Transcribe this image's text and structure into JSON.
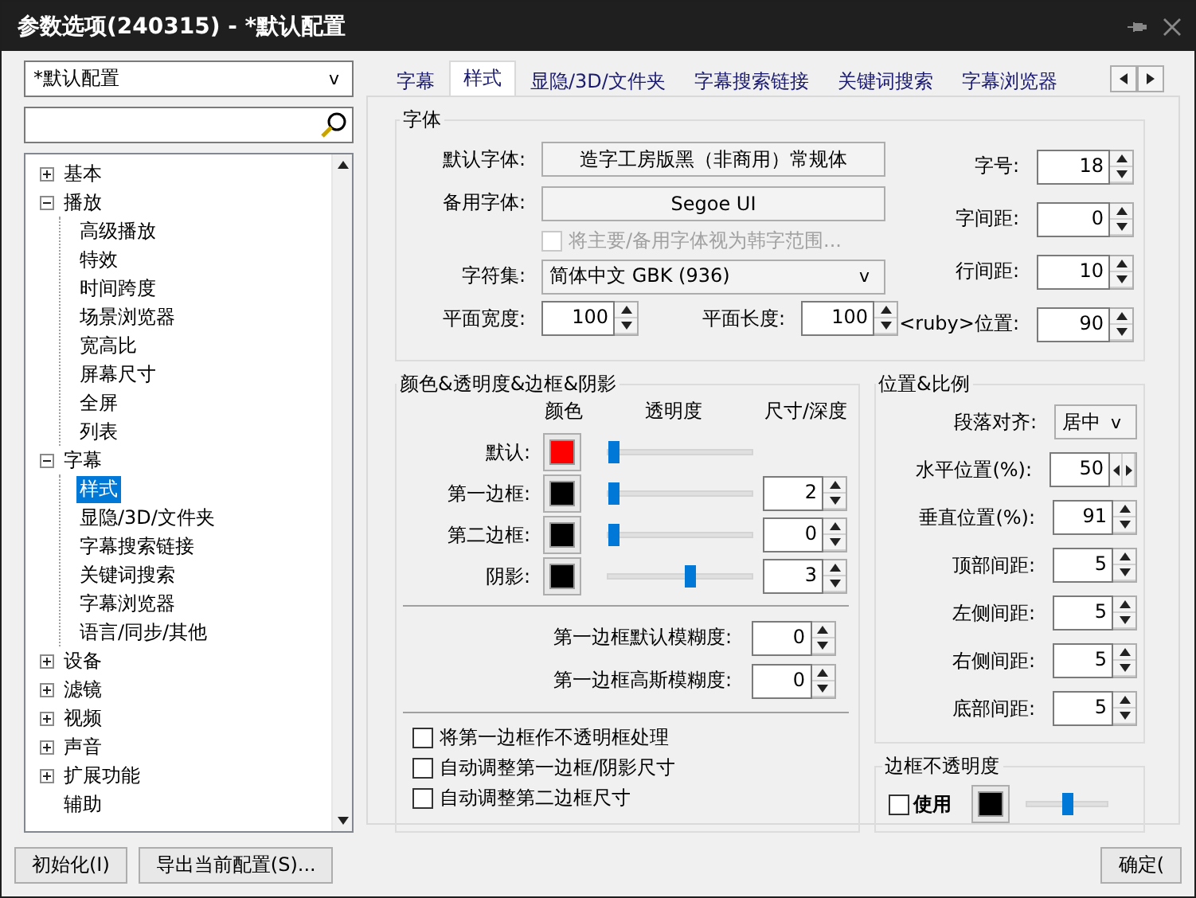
{
  "window": {
    "title": "参数选项(240315) - *默认配置"
  },
  "profile_select": {
    "value": "*默认配置",
    "caret": "v"
  },
  "tree": [
    {
      "label": "基本",
      "expanded": false,
      "selected": false
    },
    {
      "label": "播放",
      "expanded": true,
      "selected": false,
      "children": [
        {
          "label": "高级播放",
          "selected": false
        },
        {
          "label": "特效",
          "selected": false
        },
        {
          "label": "时间跨度",
          "selected": false
        },
        {
          "label": "场景浏览器",
          "selected": false
        },
        {
          "label": "宽高比",
          "selected": false
        },
        {
          "label": "屏幕尺寸",
          "selected": false
        },
        {
          "label": "全屏",
          "selected": false
        },
        {
          "label": "列表",
          "selected": false
        }
      ]
    },
    {
      "label": "字幕",
      "expanded": true,
      "selected": false,
      "children": [
        {
          "label": "样式",
          "selected": true
        },
        {
          "label": "显隐/3D/文件夹",
          "selected": false
        },
        {
          "label": "字幕搜索链接",
          "selected": false
        },
        {
          "label": "关键词搜索",
          "selected": false
        },
        {
          "label": "字幕浏览器",
          "selected": false
        },
        {
          "label": "语言/同步/其他",
          "selected": false
        }
      ]
    },
    {
      "label": "设备",
      "expanded": false,
      "selected": false
    },
    {
      "label": "滤镜",
      "expanded": false,
      "selected": false
    },
    {
      "label": "视频",
      "expanded": false,
      "selected": false
    },
    {
      "label": "声音",
      "expanded": false,
      "selected": false
    },
    {
      "label": "扩展功能",
      "expanded": false,
      "selected": false
    },
    {
      "label": "辅助",
      "selected": false
    }
  ],
  "tabs": [
    {
      "label": "字幕",
      "selected": false
    },
    {
      "label": "样式",
      "selected": true
    },
    {
      "label": "显隐/3D/文件夹",
      "selected": false
    },
    {
      "label": "字幕搜索链接",
      "selected": false
    },
    {
      "label": "关键词搜索",
      "selected": false
    },
    {
      "label": "字幕浏览器",
      "selected": false
    }
  ],
  "font_group": {
    "legend": "字体",
    "default_font": {
      "label": "默认字体:",
      "value": "造字工房版黑（非商用）常规体"
    },
    "fallback_font": {
      "label": "备用字体:",
      "value": "Segoe UI"
    },
    "korean_range": {
      "label": "将主要/备用字体视为韩字范围...",
      "checked": false,
      "disabled": true
    },
    "charset": {
      "label": "字符集:",
      "value": "简体中文 GBK (936)",
      "caret": "v"
    },
    "plane_width": {
      "label": "平面宽度:",
      "value": "100"
    },
    "plane_height": {
      "label": "平面长度:",
      "value": "100"
    },
    "metrics": [
      {
        "label": "字号:",
        "value": "18"
      },
      {
        "label": "字间距:",
        "value": "0"
      },
      {
        "label": "行间距:",
        "value": "10"
      },
      {
        "label": "<ruby>位置:",
        "value": "90"
      }
    ]
  },
  "color_group": {
    "legend": "颜色&透明度&边框&阴影",
    "headers": [
      "颜色",
      "透明度",
      "尺寸/深度"
    ],
    "rows": [
      {
        "label": "默认:",
        "color": "#ff0000",
        "level": 0.04
      },
      {
        "label": "第一边框:",
        "color": "#000000",
        "level": 0.04,
        "size": "2"
      },
      {
        "label": "第二边框:",
        "color": "#000000",
        "level": 0.04,
        "size": "0"
      },
      {
        "label": "阴影:",
        "color": "#000000",
        "level": 0.56,
        "size": "3"
      }
    ],
    "blur": [
      {
        "label": "第一边框默认模糊度:",
        "value": "0"
      },
      {
        "label": "第一边框高斯模糊度:",
        "value": "0"
      }
    ],
    "options": [
      {
        "label": "将第一边框作不透明框处理",
        "checked": false
      },
      {
        "label": "自动调整第一边框/阴影尺寸",
        "checked": false
      },
      {
        "label": "自动调整第二边框尺寸",
        "checked": false
      }
    ]
  },
  "position_group": {
    "legend": "位置&比例",
    "align": {
      "label": "段落对齐:",
      "value": "居中",
      "caret": "v"
    },
    "fields": [
      {
        "label": "水平位置(%):",
        "value": "50",
        "kind": "horizontal"
      },
      {
        "label": "垂直位置(%):",
        "value": "91",
        "kind": "vertical"
      },
      {
        "label": "顶部间距:",
        "value": "5",
        "kind": "vertical"
      },
      {
        "label": "左侧间距:",
        "value": "5",
        "kind": "vertical"
      },
      {
        "label": "右侧间距:",
        "value": "5",
        "kind": "vertical"
      },
      {
        "label": "底部间距:",
        "value": "5",
        "kind": "vertical"
      }
    ]
  },
  "border_opacity": {
    "legend": "边框不透明度",
    "use": {
      "label": "使用",
      "checked": false
    },
    "color": "#000000",
    "level": 0.5
  },
  "buttons": [
    {
      "label": "初始化(I)"
    },
    {
      "label": "导出当前配置(S)..."
    },
    {
      "label": "确定("
    }
  ]
}
